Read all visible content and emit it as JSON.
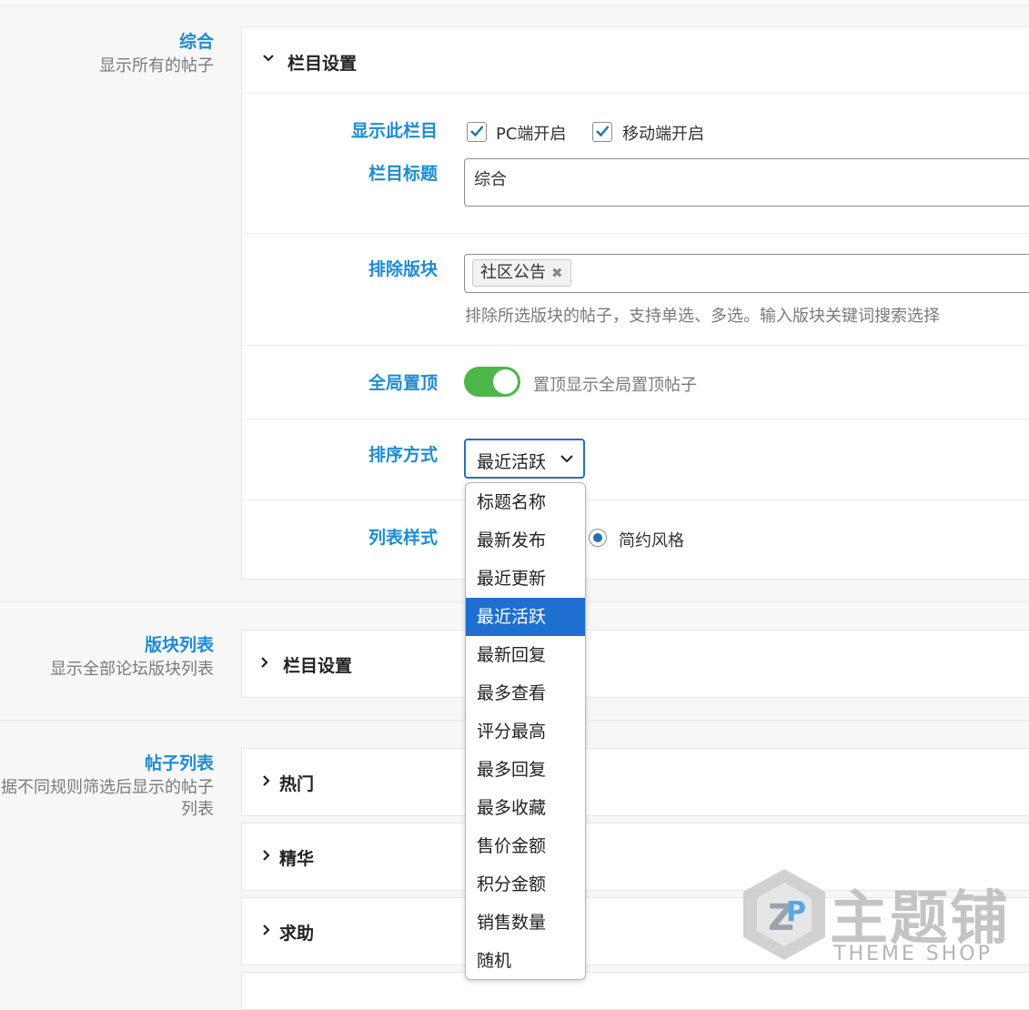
{
  "sections": [
    {
      "title": "综合",
      "desc": "显示所有的帖子"
    },
    {
      "title": "版块列表",
      "desc": "显示全部论坛版块列表"
    },
    {
      "title": "帖子列表",
      "desc": "据不同规则筛选后显示的帖子列表"
    }
  ],
  "panel1": {
    "header": "栏目设置",
    "show_label": "显示此栏目",
    "pc_label": "PC端开启",
    "mobile_label": "移动端开启",
    "title_label": "栏目标题",
    "title_value": "综合",
    "exclude_label": "排除版块",
    "exclude_tag": "社区公告",
    "exclude_hint": "排除所选版块的帖子，支持单选、多选。输入版块关键词搜索选择",
    "sticky_label": "全局置顶",
    "sticky_desc": "置顶显示全局置顶帖子",
    "sort_label": "排序方式",
    "sort_value": "最近活跃",
    "style_label": "列表样式",
    "style_option": "简约风格"
  },
  "sort_options": [
    "标题名称",
    "最新发布",
    "最近更新",
    "最近活跃",
    "最新回复",
    "最多查看",
    "评分最高",
    "最多回复",
    "最多收藏",
    "售价金额",
    "积分金额",
    "销售数量",
    "随机"
  ],
  "selected_option": "最近活跃",
  "panel2": {
    "header": "栏目设置"
  },
  "posts": [
    "热门",
    "精华",
    "求助"
  ],
  "watermark": {
    "cn": "主题铺",
    "en": "THEME SHOP"
  },
  "colors": {
    "accent": "#1e8bd3",
    "toggle_on": "#4cb648",
    "selected": "#1f6fd1"
  }
}
